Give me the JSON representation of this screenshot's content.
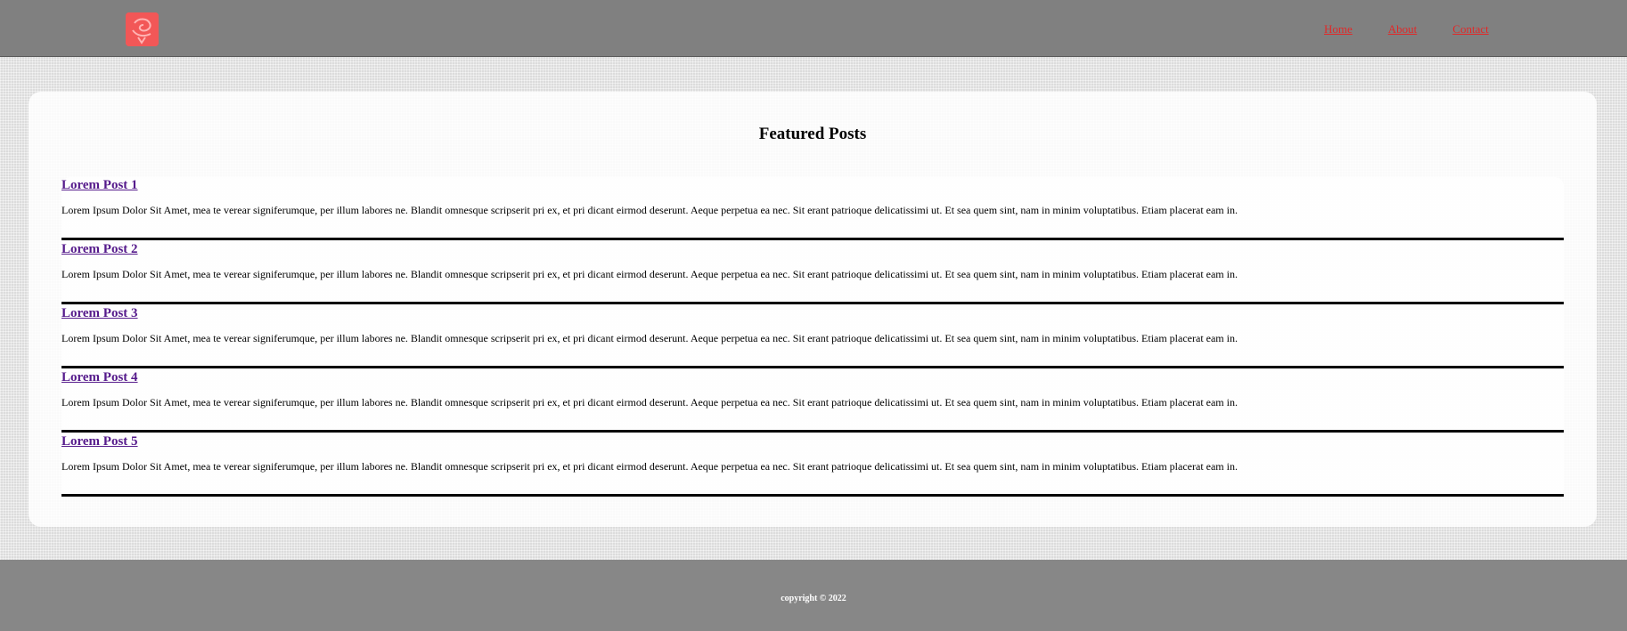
{
  "header": {
    "logo_icon": "rose-logo-icon",
    "logo_color": "#f25757",
    "nav": [
      {
        "label": "Home"
      },
      {
        "label": "About"
      },
      {
        "label": "Contact"
      }
    ]
  },
  "main": {
    "title": "Featured Posts",
    "posts": [
      {
        "title": "Lorem Post 1",
        "body": "Lorem Ipsum Dolor Sit Amet, mea te verear signiferumque, per illum labores ne. Blandit omnesque scripserit pri ex, et pri dicant eirmod deserunt. Aeque perpetua ea nec. Sit erant patrioque delicatissimi ut. Et sea quem sint, nam in minim voluptatibus. Etiam placerat eam in."
      },
      {
        "title": "Lorem Post 2",
        "body": "Lorem Ipsum Dolor Sit Amet, mea te verear signiferumque, per illum labores ne. Blandit omnesque scripserit pri ex, et pri dicant eirmod deserunt. Aeque perpetua ea nec. Sit erant patrioque delicatissimi ut. Et sea quem sint, nam in minim voluptatibus. Etiam placerat eam in."
      },
      {
        "title": "Lorem Post 3",
        "body": "Lorem Ipsum Dolor Sit Amet, mea te verear signiferumque, per illum labores ne. Blandit omnesque scripserit pri ex, et pri dicant eirmod deserunt. Aeque perpetua ea nec. Sit erant patrioque delicatissimi ut. Et sea quem sint, nam in minim voluptatibus. Etiam placerat eam in."
      },
      {
        "title": "Lorem Post 4",
        "body": "Lorem Ipsum Dolor Sit Amet, mea te verear signiferumque, per illum labores ne. Blandit omnesque scripserit pri ex, et pri dicant eirmod deserunt. Aeque perpetua ea nec. Sit erant patrioque delicatissimi ut. Et sea quem sint, nam in minim voluptatibus. Etiam placerat eam in."
      },
      {
        "title": "Lorem Post 5",
        "body": "Lorem Ipsum Dolor Sit Amet, mea te verear signiferumque, per illum labores ne. Blandit omnesque scripserit pri ex, et pri dicant eirmod deserunt. Aeque perpetua ea nec. Sit erant patrioque delicatissimi ut. Et sea quem sint, nam in minim voluptatibus. Etiam placerat eam in."
      }
    ]
  },
  "footer": {
    "copyright": "copyright © 2022"
  },
  "colors": {
    "header_bg": "#808080",
    "footer_bg": "#878787",
    "nav_link": "#e02929",
    "post_link": "#551a8b"
  }
}
